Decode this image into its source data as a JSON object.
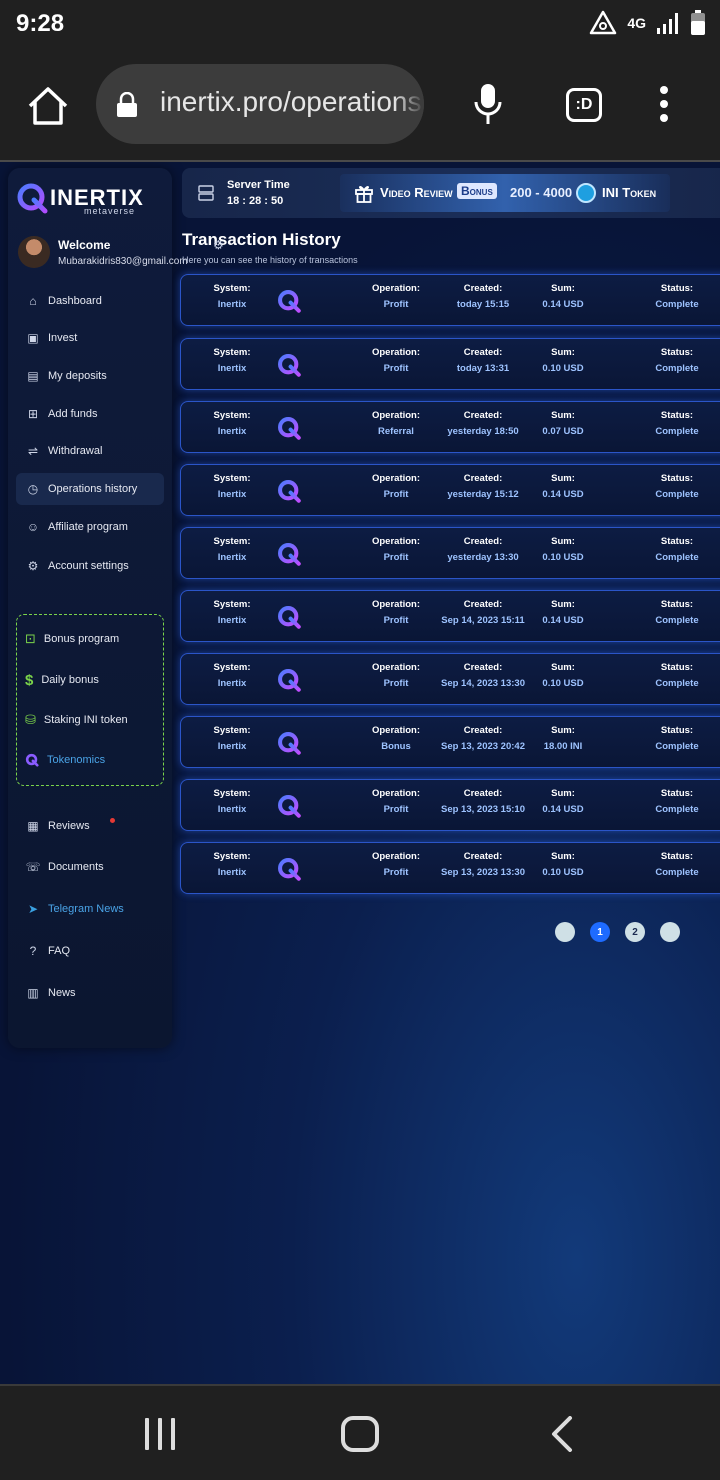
{
  "status_bar": {
    "time": "9:28",
    "network": "4G"
  },
  "browser": {
    "url": "inertix.pro/operations",
    "tabs_label": ":D"
  },
  "brand": {
    "name": "INERTIX",
    "sub": "metaverse"
  },
  "user": {
    "welcome": "Welcome",
    "email": "Mubarakidris830@gmail.com"
  },
  "nav": [
    {
      "label": "Dashboard",
      "icon": "home-icon"
    },
    {
      "label": "Invest",
      "icon": "wallet-icon"
    },
    {
      "label": "My deposits",
      "icon": "deposits-icon"
    },
    {
      "label": "Add funds",
      "icon": "add-funds-icon"
    },
    {
      "label": "Withdrawal",
      "icon": "withdraw-icon"
    },
    {
      "label": "Operations history",
      "icon": "history-icon"
    },
    {
      "label": "Affiliate program",
      "icon": "users-icon"
    },
    {
      "label": "Account settings",
      "icon": "gear-icon"
    }
  ],
  "bonus_nav": [
    {
      "label": "Bonus program",
      "icon": "gift-icon"
    },
    {
      "label": "Daily bonus",
      "icon": "dollar-icon"
    },
    {
      "label": "Staking INI token",
      "icon": "coins-icon"
    },
    {
      "label": "Tokenomics",
      "icon": "inertix-logo-icon"
    }
  ],
  "nav_bottom": [
    {
      "label": "Reviews",
      "icon": "reviews-icon"
    },
    {
      "label": "Documents",
      "icon": "chat-icon"
    },
    {
      "label": "Telegram News",
      "icon": "telegram-icon"
    },
    {
      "label": "FAQ",
      "icon": "question-icon"
    },
    {
      "label": "News",
      "icon": "newspaper-icon"
    }
  ],
  "server": {
    "label": "Server Time",
    "time": "18 : 28 : 50"
  },
  "promo": {
    "text": "Video Review",
    "chip": "Bonus",
    "range": "200 - 4000",
    "token": "INI Token"
  },
  "header": {
    "title": "Transaction History",
    "subtitle": "Here you can see the history of transactions"
  },
  "labels": {
    "system": "System:",
    "operation": "Operation:",
    "created": "Created:",
    "sum": "Sum:",
    "status": "Status:"
  },
  "transactions": [
    {
      "system": "Inertix",
      "operation": "Profit",
      "created": "today 15:15",
      "sum": "0.14 USD",
      "status": "Complete"
    },
    {
      "system": "Inertix",
      "operation": "Profit",
      "created": "today 13:31",
      "sum": "0.10 USD",
      "status": "Complete"
    },
    {
      "system": "Inertix",
      "operation": "Referral",
      "created": "yesterday 18:50",
      "sum": "0.07 USD",
      "status": "Complete"
    },
    {
      "system": "Inertix",
      "operation": "Profit",
      "created": "yesterday 15:12",
      "sum": "0.14 USD",
      "status": "Complete"
    },
    {
      "system": "Inertix",
      "operation": "Profit",
      "created": "yesterday 13:30",
      "sum": "0.10 USD",
      "status": "Complete"
    },
    {
      "system": "Inertix",
      "operation": "Profit",
      "created": "Sep 14, 2023 15:11",
      "sum": "0.14 USD",
      "status": "Complete"
    },
    {
      "system": "Inertix",
      "operation": "Profit",
      "created": "Sep 14, 2023 13:30",
      "sum": "0.10 USD",
      "status": "Complete"
    },
    {
      "system": "Inertix",
      "operation": "Bonus",
      "created": "Sep 13, 2023 20:42",
      "sum": "18.00 INI",
      "status": "Complete"
    },
    {
      "system": "Inertix",
      "operation": "Profit",
      "created": "Sep 13, 2023 15:10",
      "sum": "0.14 USD",
      "status": "Complete"
    },
    {
      "system": "Inertix",
      "operation": "Profit",
      "created": "Sep 13, 2023 13:30",
      "sum": "0.10 USD",
      "status": "Complete"
    }
  ],
  "pagination": {
    "pages": [
      "",
      "1",
      "2",
      ""
    ],
    "active": "1"
  },
  "colors": {
    "accent": "#1e6bff",
    "row_border": "#2b55c8",
    "value_text": "#9ec3ff",
    "bonus_border": "#7bd44a"
  }
}
